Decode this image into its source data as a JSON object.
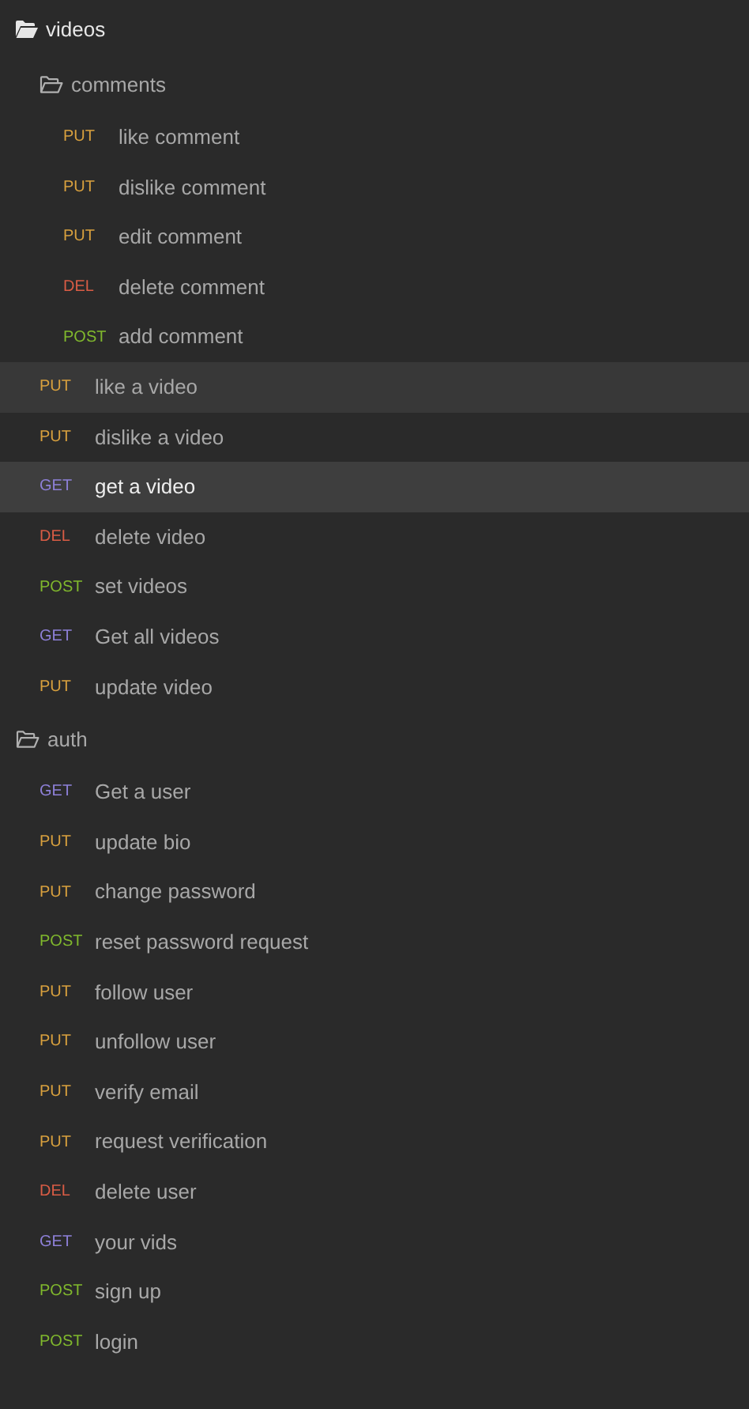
{
  "tree": [
    {
      "kind": "folder",
      "name": "videos",
      "expanded": true,
      "active": true,
      "children": [
        {
          "kind": "folder",
          "name": "comments",
          "expanded": true,
          "active": false,
          "children": [
            {
              "kind": "request",
              "method": "PUT",
              "color": "#d8a03e",
              "name": "like comment",
              "selected": false,
              "hovered": false
            },
            {
              "kind": "request",
              "method": "PUT",
              "color": "#d8a03e",
              "name": "dislike comment",
              "selected": false,
              "hovered": false
            },
            {
              "kind": "request",
              "method": "PUT",
              "color": "#d8a03e",
              "name": "edit comment",
              "selected": false,
              "hovered": false
            },
            {
              "kind": "request",
              "method": "DEL",
              "color": "#d95c45",
              "name": "delete comment",
              "selected": false,
              "hovered": false
            },
            {
              "kind": "request",
              "method": "POST",
              "color": "#80b82d",
              "name": "add comment",
              "selected": false,
              "hovered": false
            }
          ]
        },
        {
          "kind": "request",
          "method": "PUT",
          "color": "#d8a03e",
          "name": "like a video",
          "selected": false,
          "hovered": true
        },
        {
          "kind": "request",
          "method": "PUT",
          "color": "#d8a03e",
          "name": "dislike a video",
          "selected": false,
          "hovered": false
        },
        {
          "kind": "request",
          "method": "GET",
          "color": "#8e80d8",
          "name": "get a video",
          "selected": true,
          "hovered": false
        },
        {
          "kind": "request",
          "method": "DEL",
          "color": "#d95c45",
          "name": "delete video",
          "selected": false,
          "hovered": false
        },
        {
          "kind": "request",
          "method": "POST",
          "color": "#80b82d",
          "name": "set videos",
          "selected": false,
          "hovered": false
        },
        {
          "kind": "request",
          "method": "GET",
          "color": "#8e80d8",
          "name": "Get all videos",
          "selected": false,
          "hovered": false
        },
        {
          "kind": "request",
          "method": "PUT",
          "color": "#d8a03e",
          "name": "update video",
          "selected": false,
          "hovered": false
        }
      ]
    },
    {
      "kind": "folder",
      "name": "auth",
      "expanded": true,
      "active": false,
      "children": [
        {
          "kind": "request",
          "method": "GET",
          "color": "#8e80d8",
          "name": "Get a user",
          "selected": false,
          "hovered": false
        },
        {
          "kind": "request",
          "method": "PUT",
          "color": "#d8a03e",
          "name": "update bio",
          "selected": false,
          "hovered": false
        },
        {
          "kind": "request",
          "method": "PUT",
          "color": "#d8a03e",
          "name": "change password",
          "selected": false,
          "hovered": false
        },
        {
          "kind": "request",
          "method": "POST",
          "color": "#80b82d",
          "name": "reset password request",
          "selected": false,
          "hovered": false
        },
        {
          "kind": "request",
          "method": "PUT",
          "color": "#d8a03e",
          "name": "follow user",
          "selected": false,
          "hovered": false
        },
        {
          "kind": "request",
          "method": "PUT",
          "color": "#d8a03e",
          "name": "unfollow user",
          "selected": false,
          "hovered": false
        },
        {
          "kind": "request",
          "method": "PUT",
          "color": "#d8a03e",
          "name": "verify email",
          "selected": false,
          "hovered": false
        },
        {
          "kind": "request",
          "method": "PUT",
          "color": "#d8a03e",
          "name": "request verification",
          "selected": false,
          "hovered": false
        },
        {
          "kind": "request",
          "method": "DEL",
          "color": "#d95c45",
          "name": "delete user",
          "selected": false,
          "hovered": false
        },
        {
          "kind": "request",
          "method": "GET",
          "color": "#8e80d8",
          "name": "your vids",
          "selected": false,
          "hovered": false
        },
        {
          "kind": "request",
          "method": "POST",
          "color": "#80b82d",
          "name": "sign up",
          "selected": false,
          "hovered": false
        },
        {
          "kind": "request",
          "method": "POST",
          "color": "#80b82d",
          "name": "login",
          "selected": false,
          "hovered": false
        }
      ]
    }
  ]
}
